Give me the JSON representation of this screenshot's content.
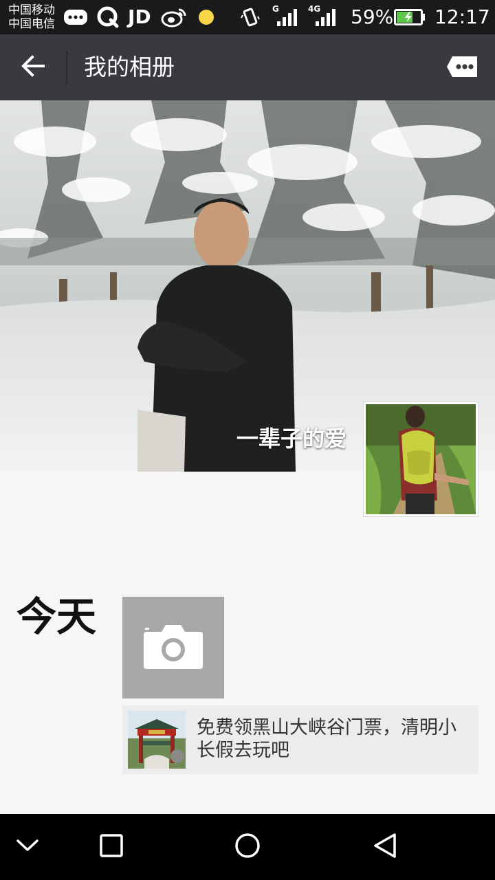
{
  "status_bar": {
    "carrier_1": "中国移动",
    "carrier_2": "中国电信",
    "jd_label": "JD",
    "signal_1_label": "G",
    "signal_2_label": "4G",
    "battery_percent": "59%",
    "time": "12:17",
    "icons": [
      "message-icon",
      "q-app-icon",
      "jd-icon",
      "weibo-icon",
      "yellow-dot-icon",
      "vibrate-icon",
      "signal-icon",
      "signal-icon",
      "battery-icon"
    ]
  },
  "app_bar": {
    "title": "我的相册",
    "back_icon": "arrow-left-icon",
    "message_icon": "chat-bubble-icon"
  },
  "cover": {
    "nickname": "一辈子的爱"
  },
  "timeline": {
    "day_label": "今天",
    "camera_icon": "camera-icon",
    "share_text": "免费领黑山大峡谷门票，清明小长假去玩吧"
  },
  "nav_bar": {
    "icons": [
      "chevron-down-icon",
      "square-icon",
      "circle-icon",
      "triangle-back-icon"
    ]
  },
  "colors": {
    "status_bar_bg": "#1a1a1a",
    "app_bar_bg": "#393a3f",
    "page_bg": "#f6f6f6",
    "camera_tile_bg": "#a8a8a8",
    "share_card_bg": "#ececec",
    "nav_bar_bg": "#000000"
  }
}
